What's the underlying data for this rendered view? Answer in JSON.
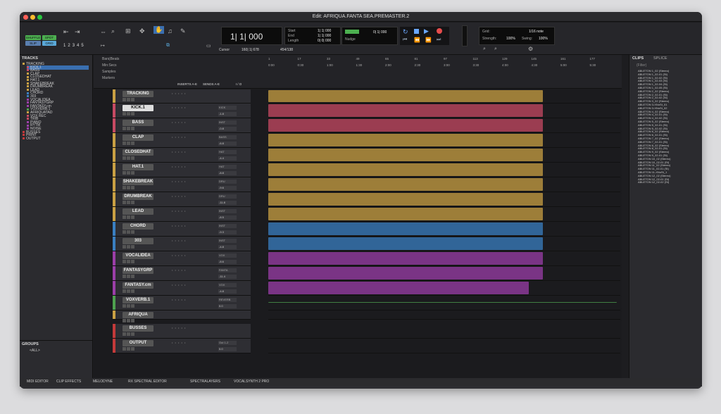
{
  "window": {
    "title": "Edit: AFRIQUA.FANTA SEA.PREMASTER.2"
  },
  "toolbar": {
    "modes": [
      "SHUFFLE",
      "SPOT",
      "SLIP",
      "GRID"
    ],
    "counter_main": "1| 1| 000",
    "start_label": "Start",
    "end_label": "End",
    "length_label": "Length",
    "start": "1| 1| 000",
    "end": "1| 1| 000",
    "length": "0| 0| 000",
    "cursor_label": "Cursor",
    "cursor_value": "160| 1| 678",
    "tempo": "454/138",
    "nudge_label": "Nudge",
    "nudge_value": "0| 1| 000",
    "grid_label": "Grid:",
    "grid_value": "1/16 note",
    "strength_label": "Strength:",
    "strength_value": "100%",
    "swing_label": "Swing:",
    "swing_value": "100%",
    "numbers": [
      "1",
      "2",
      "3",
      "4",
      "5"
    ]
  },
  "tracks_panel": {
    "header": "TRACKS",
    "items": [
      "TRACKING",
      "KICK.1",
      "BASS",
      "CLAP",
      "CLOSEDHAT",
      "HAT.1",
      "SHAKEBREAK",
      "DRUMBREAK",
      "LEAD",
      "CHORD",
      "303",
      "VOCALIDEA",
      "FANTASYGRP",
      "FANTASY.cm",
      "VOXVERB.1",
      "AFRIQUATAD",
      "VOX REC",
      "TRIB",
      "PIANO",
      "RYTM",
      "NOISE",
      "BUSSES",
      "PRINT",
      "OUTPUT"
    ]
  },
  "groups": {
    "header": "GROUPS",
    "item": "<ALL>"
  },
  "rulers": {
    "labels": [
      "Bars|Beats",
      "Min:Secs",
      "Samples",
      "Markers"
    ],
    "ticks": [
      "1",
      "17",
      "33",
      "49",
      "65",
      "81",
      "97",
      "113",
      "129",
      "145",
      "161",
      "177"
    ],
    "secs": [
      "0:00",
      "0:30",
      "1:00",
      "1:30",
      "2:00",
      "2:30",
      "3:00",
      "3:30",
      "4:00",
      "4:30",
      "5:00",
      "5:30"
    ]
  },
  "edit_header": {
    "inserts": "INSERTS A-E",
    "sends": "SENDS A-E",
    "io": "I / O"
  },
  "edit_tracks": [
    {
      "name": "TRACKING",
      "io": "",
      "vol": "",
      "color": "#c9a043"
    },
    {
      "name": "KICK.1",
      "io": "KICK",
      "vol": "-1.8",
      "color": "#c74a63"
    },
    {
      "name": "BASS",
      "io": "INST",
      "vol": "-0.8",
      "color": "#c74a63"
    },
    {
      "name": "CLAP",
      "io": "BASS",
      "vol": "-6.8",
      "color": "#c9a043"
    },
    {
      "name": "CLOSEDHAT",
      "io": "HAT",
      "vol": "-4.4",
      "color": "#c9a043"
    },
    {
      "name": "HAT.1",
      "io": "HAT",
      "vol": "-8.8",
      "color": "#c9a043"
    },
    {
      "name": "SHAKEBREAK",
      "io": "DRU",
      "vol": "-9.6",
      "color": "#c9a043"
    },
    {
      "name": "DRUMBREAK",
      "io": "DRU",
      "vol": "-11.8",
      "color": "#c9a043"
    },
    {
      "name": "LEAD",
      "io": "INST",
      "vol": "-8.5",
      "color": "#c9a043"
    },
    {
      "name": "CHORD",
      "io": "INST",
      "vol": "-9.3",
      "color": "#3a7fc1"
    },
    {
      "name": "303",
      "io": "INST",
      "vol": "-4.8",
      "color": "#3a7fc1"
    },
    {
      "name": "VOCALIDEA",
      "io": "VOX",
      "vol": "-8.6",
      "color": "#9b3ea8"
    },
    {
      "name": "FANTASYGRP",
      "io": "FANTA",
      "vol": "-11.4",
      "color": "#9b3ea8"
    },
    {
      "name": "FANTASY.cm",
      "io": "VOX",
      "vol": "-4.8",
      "color": "#9b3ea8"
    },
    {
      "name": "VOXVERB.1",
      "io": "REVERB",
      "vol": "0.0",
      "color": "#4ea14e"
    },
    {
      "name": "AFRIQUA",
      "io": "",
      "vol": "",
      "color": "#c9a043"
    },
    {
      "name": "BUSSES",
      "io": "",
      "vol": "",
      "color": "#c43a3a"
    },
    {
      "name": "OUTPUT",
      "io": "Out 1-2",
      "vol": "0.0",
      "color": "#c43a3a"
    }
  ],
  "clips_panel": {
    "tabs": [
      "CLIPS",
      "SPLICE"
    ],
    "filter": "(Filter)",
    "items": [
      "ABLETON 1_02 (Stereo)",
      "ABLETON 1_02-01 (St)",
      "ABLETON 1_02-02 (St)",
      "ABLETON 1_02-03 (St)",
      "ABLETON 1_02-04 (St)",
      "ABLETON 1_02-05 (St)",
      "ABLETON 2_02 (Stereo)",
      "ABLETON 2_02-01 (St)",
      "ABLETON 2_02-02 (St)",
      "ABLETON 3_02 (Stereo)",
      "ABLETON 3-XNoSt_01",
      "ABLETON 3-XNoSt_02",
      "ABLETON 4_02 (Stereo)",
      "ABLETON 4_02-01 (St)",
      "ABLETON 4_02-02 (St)",
      "ABLETON 5_02 (Stereo)",
      "ABLETON 5_02-01 (St)",
      "ABLETON 5_02-02 (St)",
      "ABLETON 6_02 (Stereo)",
      "ABLETON 6_02-01 (St)",
      "ABLETON 7_02 (Stereo)",
      "ABLETON 7_02-01 (St)",
      "ABLETON 8_02 (Stereo)",
      "ABLETON 8_02-01 (St)",
      "ABLETON 9_02 (Stereo)",
      "ABLETON 9_02-01 (St)",
      "ABLETON 10_02 (Stereo)",
      "ABLETON 10_02-01 (St)",
      "ABLETON 11_02 (Stereo)",
      "ABLETON 11_02-01 (St)",
      "ABLETON 11-XNoSt_1",
      "ABLETON 12_02 (Stereo)",
      "ABLETON 12_02-01 (St)",
      "ABLETON 12_02-02 (St)"
    ]
  },
  "bottom_tabs": [
    "MIDI EDITOR",
    "CLIP EFFECTS",
    "MELODYNE",
    "RX SPECTRAL EDITOR",
    "SPECTRALAYERS",
    "VOCALSYNTH 2 PRO"
  ]
}
